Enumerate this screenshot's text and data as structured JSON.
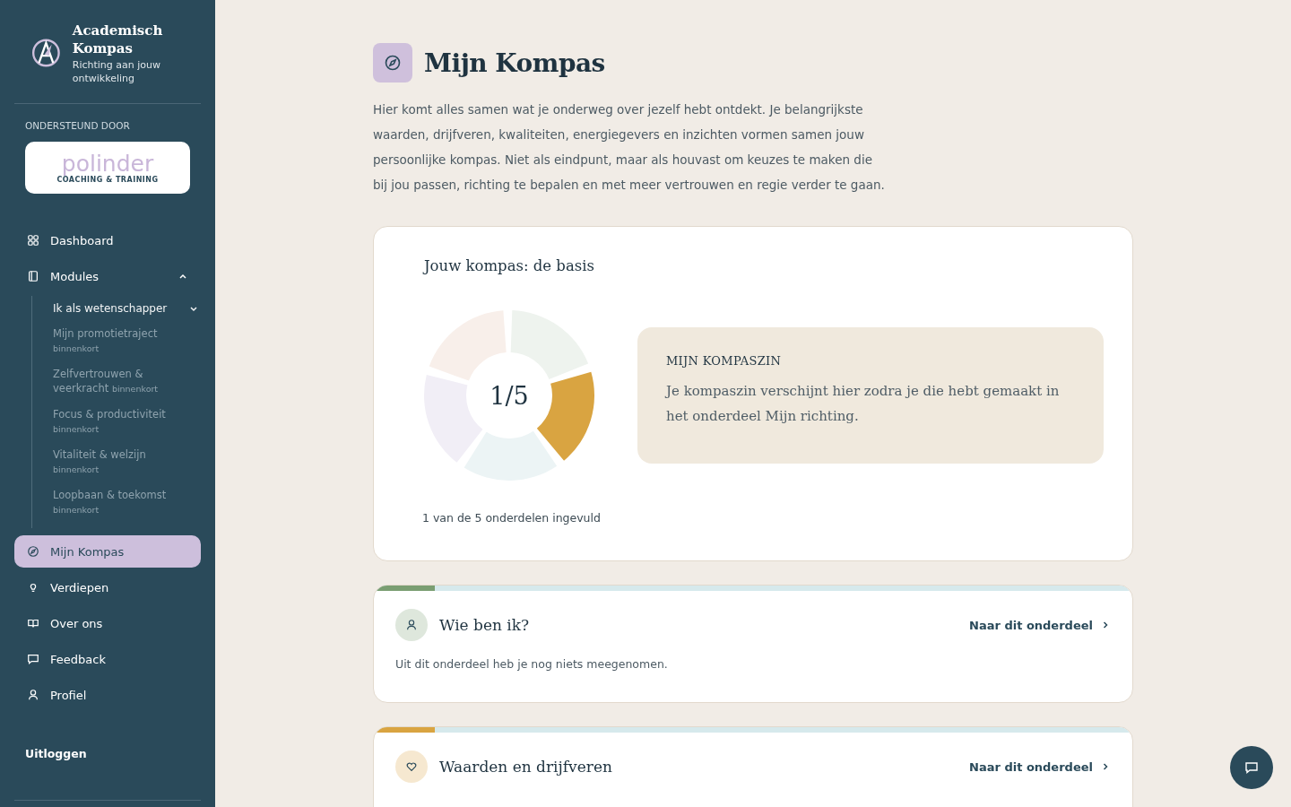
{
  "sidebar": {
    "brand": {
      "title": "Academisch Kompas",
      "subtitle": "Richting aan jouw ontwikkeling"
    },
    "sponsor": {
      "label": "ONDERSTEUND DOOR",
      "logo_name": "polinder",
      "logo_tagline": "COACHING & TRAINING"
    },
    "items": [
      {
        "label": "Dashboard",
        "selected": false
      },
      {
        "label": "Modules",
        "selected": false,
        "expanded": true,
        "children": [
          {
            "label": "Ik als wetenschapper",
            "expanded": false,
            "kind": "group"
          },
          {
            "label": "Mijn promotietraject",
            "tag": "binnenkort",
            "kind": "soon"
          },
          {
            "label": "Zelfvertrouwen & veerkracht",
            "tag": "binnenkort",
            "kind": "soon"
          },
          {
            "label": "Focus & productiviteit",
            "tag": "binnenkort",
            "kind": "soon"
          },
          {
            "label": "Vitaliteit & welzijn",
            "tag": "binnenkort",
            "kind": "soon"
          },
          {
            "label": "Loopbaan & toekomst",
            "tag": "binnenkort",
            "kind": "soon"
          }
        ]
      },
      {
        "label": "Mijn Kompas",
        "selected": true
      },
      {
        "label": "Verdiepen",
        "selected": false
      },
      {
        "label": "Over ons",
        "selected": false
      },
      {
        "label": "Feedback",
        "selected": false
      },
      {
        "label": "Profiel",
        "selected": false
      }
    ],
    "logout": "Uitloggen"
  },
  "page": {
    "title": "Mijn Kompas",
    "intro": "Hier komt alles samen wat je onderweg over jezelf hebt ontdekt. Je belangrijkste waarden, drijfveren, kwaliteiten, energiegevers en inzichten vormen samen jouw persoonlijke kompas. Niet als eindpunt, maar als houvast om keuzes te maken die bij jou passen, richting te bepalen en met meer vertrouwen en regie verder te gaan."
  },
  "overview": {
    "title": "Jouw kompas: de basis",
    "progress_label": "1/5",
    "caption": "1 van de 5 onderdelen ingevuld",
    "segments": [
      {
        "color": "#eef3ee"
      },
      {
        "color": "#d9a441"
      },
      {
        "color": "#ecf4f5"
      },
      {
        "color": "#f1eef6"
      },
      {
        "color": "#f8efea"
      }
    ],
    "sentence": {
      "label": "MIJN KOMPASZIN",
      "text": "Je kompaszin verschijnt hier zodra je die hebt gemaakt in het onderdeel Mijn richting."
    }
  },
  "sections": [
    {
      "title": "Wie ben ik?",
      "color": "#7a9e72",
      "level": 0.08,
      "link": "Naar dit onderdeel",
      "text": "Uit dit onderdeel heb je nog niets meegenomen."
    },
    {
      "title": "Waarden en drijfveren",
      "color": "#d9a441",
      "level": 0.08,
      "link": "Naar dit onderdeel"
    }
  ]
}
